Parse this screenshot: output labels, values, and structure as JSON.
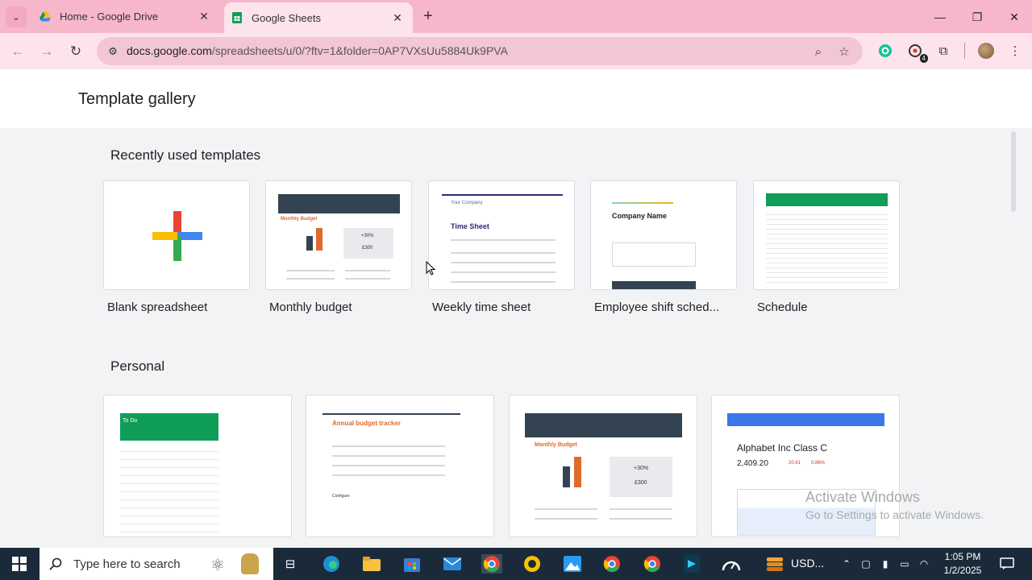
{
  "browser": {
    "tabs": [
      {
        "title": "Home - Google Drive",
        "active": false
      },
      {
        "title": "Google Sheets",
        "active": true
      }
    ],
    "url_host": "docs.google.com",
    "url_path": "/spreadsheets/u/0/?ftv=1&folder=0AP7VXsUu5884Uk9PVA",
    "extension_badge": "4"
  },
  "page": {
    "title": "Template gallery"
  },
  "sections": {
    "recent": {
      "title": "Recently used templates",
      "items": [
        {
          "label": "Blank spreadsheet"
        },
        {
          "label": "Monthly budget",
          "thumb_title": "Monthly Budget",
          "thumb_pct": "+30%",
          "thumb_amount": "£300"
        },
        {
          "label": "Weekly time sheet",
          "thumb_company": "Your Company",
          "thumb_title": "Time Sheet"
        },
        {
          "label": "Employee shift sched...",
          "thumb_title": "Company Name"
        },
        {
          "label": "Schedule"
        }
      ]
    },
    "personal": {
      "title": "Personal",
      "items": [
        {
          "thumb_title": "To Do"
        },
        {
          "thumb_title": "Annual budget tracker",
          "thumb_sub": "Configure"
        },
        {
          "thumb_title": "Monthly Budget",
          "thumb_pct": "+30%",
          "thumb_amount": "£300"
        },
        {
          "thumb_title": "Alphabet Inc Class C",
          "thumb_price": "2,409.20",
          "thumb_change": "20.61",
          "thumb_change_pct": "0.86%"
        }
      ]
    }
  },
  "watermark": {
    "line1": "Activate Windows",
    "line2": "Go to Settings to activate Windows."
  },
  "taskbar": {
    "search_placeholder": "Type here to search",
    "currency_widget": "USD...",
    "time": "1:05 PM",
    "date": "1/2/2025"
  }
}
